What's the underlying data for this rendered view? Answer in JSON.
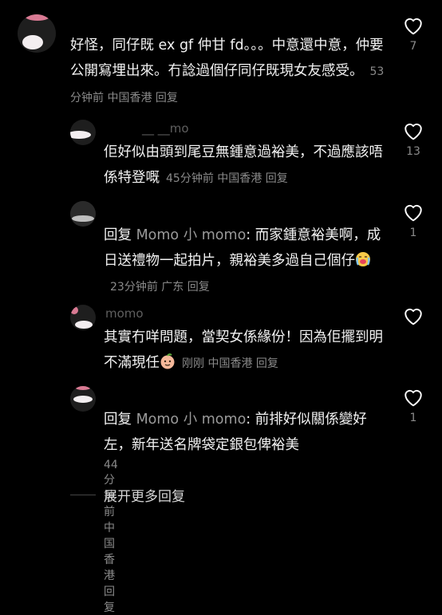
{
  "comments": [
    {
      "username": "",
      "text": "好怪，同仔既 ex gf 仲甘 fd。。。中意還中意，仲要公開寫埋出來。冇諗過個仔同仔既現女友感受。",
      "time": "53分钟前",
      "location": "中国香港",
      "reply_label": "回复",
      "likes": "7"
    },
    {
      "username": "__ __mo",
      "text": "佢好似由頭到尾豆無鍾意過裕美，不過應該唔係特登嘅",
      "time": "45分钟前",
      "location": "中国香港",
      "reply_label": "回复",
      "likes": "13"
    },
    {
      "username": "",
      "reply_prefix": "回复",
      "reply_to": "Momo 小 momo",
      "text": ": 而家鍾意裕美啊，成日送禮物一起拍片，親裕美多過自己個仔",
      "time": "23分钟前",
      "location": "广东",
      "reply_label": "回复",
      "likes": "1"
    },
    {
      "username": "momo",
      "text": "其實冇咩問題，當契女係緣份！因為佢擺到明不滿現任",
      "time": "刚刚",
      "location": "中国香港",
      "reply_label": "回复",
      "likes": ""
    },
    {
      "username": "",
      "reply_prefix": "回复",
      "reply_to": "Momo 小 momo",
      "text": ": 前排好似關係變好左，新年送名牌袋定銀包俾裕美",
      "time": "44分钟前",
      "location": "中国香港",
      "reply_label": "回复",
      "likes": "1"
    }
  ],
  "more_replies_label": "展开更多回复",
  "colors": {
    "background": "#000000",
    "text": "#f2f2f2",
    "meta": "#8a8a8a",
    "heart_outline": "#ffffff"
  },
  "icons": {
    "like": "heart-outline-icon",
    "emoji_crying": "crying-face-emoji",
    "emoji_peach": "peach-face-emoji"
  }
}
